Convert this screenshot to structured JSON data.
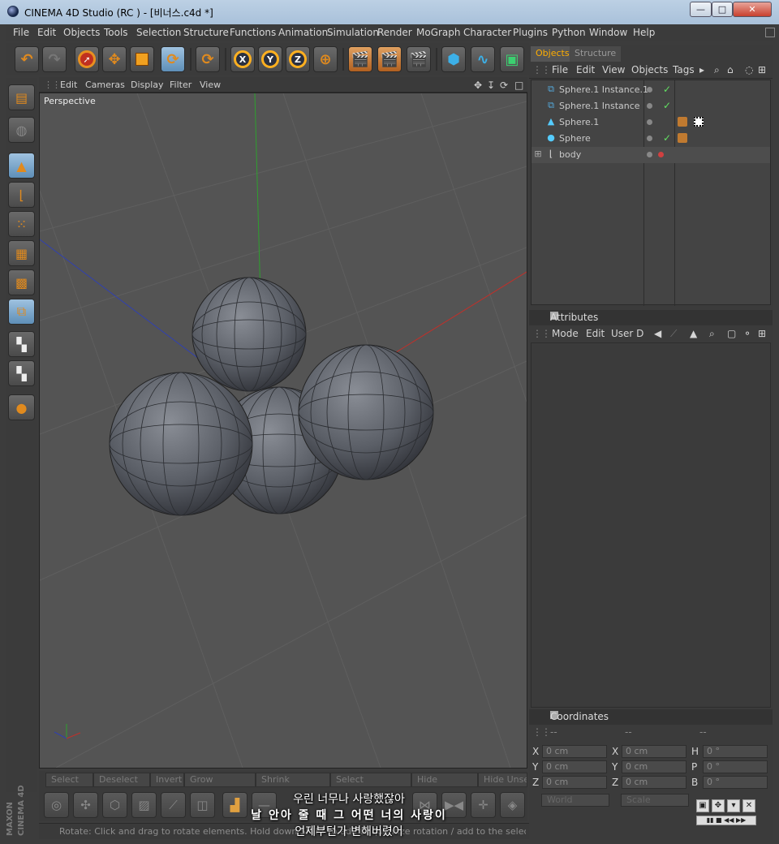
{
  "window": {
    "title": "CINEMA 4D Studio (RC ) - [비너스.c4d *]"
  },
  "window_controls": {
    "minimize": "—",
    "maximize": "□",
    "close": "✕"
  },
  "menubar": [
    "File",
    "Edit",
    "Objects",
    "Tools",
    "Selection",
    "Structure",
    "Functions",
    "Animation",
    "Simulation",
    "Render",
    "MoGraph",
    "Character",
    "Plugins",
    "Python",
    "Window",
    "Help"
  ],
  "toolbar": {
    "x_label": "X",
    "y_label": "Y",
    "z_label": "Z"
  },
  "viewport": {
    "menu": [
      "Edit",
      "Cameras",
      "Display",
      "Filter",
      "View"
    ],
    "label": "Perspective"
  },
  "bottom_selection": [
    "Select All",
    "Deselect All",
    "Invert",
    "Grow Selection",
    "Shrink Selection",
    "Select Connected",
    "Hide Selected",
    "Hide Unsele"
  ],
  "statusbar": {
    "text": "Rotate: Click and drag to rotate elements. Hold down SHIFT to add to quantize rotation / add to the selection in point mode"
  },
  "subtitle": {
    "line1": "우린 너무나 사랑했잖아",
    "line2": "날 안아 줄 때 그 어떤 너의 사랑이",
    "line3": "언제부턴가 변해버렸어"
  },
  "object_manager": {
    "tabs": [
      "Objects",
      "Structure"
    ],
    "menu": [
      "File",
      "Edit",
      "View",
      "Objects",
      "Tags"
    ],
    "objects": [
      {
        "name": "Sphere.1 Instance.1",
        "check": "✓"
      },
      {
        "name": "Sphere.1 Instance",
        "check": "✓"
      },
      {
        "name": "Sphere.1",
        "check": ""
      },
      {
        "name": "Sphere",
        "check": "✓"
      },
      {
        "name": "body",
        "check": ""
      }
    ]
  },
  "attributes": {
    "title": "Attributes",
    "menu": [
      "Mode",
      "Edit",
      "User D"
    ]
  },
  "coordinates": {
    "title": "Coordinates",
    "col_headers": [
      "--",
      "--",
      "--"
    ],
    "rows": [
      {
        "axis": "X",
        "pos": "0 cm",
        "sizeaxis": "X",
        "size": "0 cm",
        "rotaxis": "H",
        "rot": "0 °"
      },
      {
        "axis": "Y",
        "pos": "0 cm",
        "sizeaxis": "Y",
        "size": "0 cm",
        "rotaxis": "P",
        "rot": "0 °"
      },
      {
        "axis": "Z",
        "pos": "0 cm",
        "sizeaxis": "Z",
        "size": "0 cm",
        "rotaxis": "B",
        "rot": "0 °"
      }
    ],
    "world": "World",
    "scale": "Scale"
  },
  "brand": {
    "text": "MAXON CINEMA 4D"
  },
  "colors": {
    "accent": "#ffae00",
    "x_axis": "#c0302a",
    "y_axis": "#2ea02e",
    "z_axis": "#3040b0"
  }
}
